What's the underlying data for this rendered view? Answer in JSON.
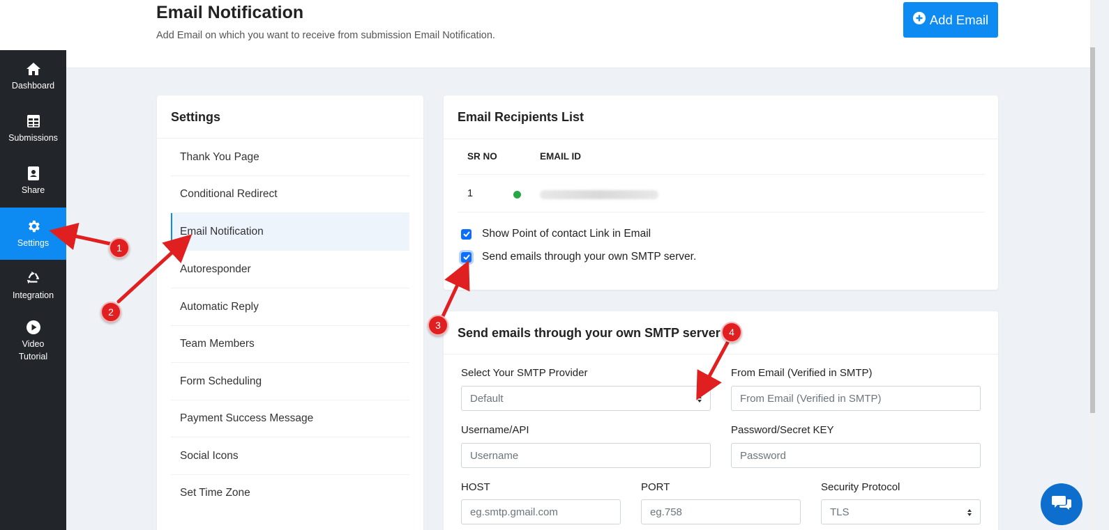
{
  "sidebar": {
    "items": [
      {
        "label": "Dashboard",
        "icon": "home-icon"
      },
      {
        "label": "Submissions",
        "icon": "table-icon"
      },
      {
        "label": "Share",
        "icon": "share-icon"
      },
      {
        "label": "Settings",
        "icon": "gear-icon",
        "active": true
      },
      {
        "label": "Integration",
        "icon": "recycle-icon"
      },
      {
        "label": "Video\nTutorial",
        "icon": "play-icon"
      }
    ]
  },
  "header": {
    "title": "Email Notification",
    "subtitle": "Add Email on which you want to receive from submission Email Notification.",
    "add_button": "Add Email"
  },
  "settings": {
    "title": "Settings",
    "items": [
      "Thank You Page",
      "Conditional Redirect",
      "Email Notification",
      "Autoresponder",
      "Automatic Reply",
      "Team Members",
      "Form Scheduling",
      "Payment Success Message",
      "Social Icons",
      "Set Time Zone"
    ],
    "active_index": 2
  },
  "recipients": {
    "title": "Email Recipients List",
    "columns": [
      "SR NO",
      "EMAIL ID"
    ],
    "rows": [
      {
        "sr": "1",
        "status": "active"
      }
    ],
    "checkbox_contact": "Show Point of contact Link in Email",
    "checkbox_smtp": "Send emails through your own SMTP server."
  },
  "smtp": {
    "title": "Send emails through your own SMTP server",
    "provider_label": "Select Your SMTP Provider",
    "provider_value": "Default",
    "from_label": "From Email (Verified in SMTP)",
    "from_placeholder": "From Email (Verified in SMTP)",
    "username_label": "Username/API",
    "username_placeholder": "Username",
    "password_label": "Password/Secret KEY",
    "password_placeholder": "Password",
    "host_label": "HOST",
    "host_placeholder": "eg.smtp.gmail.com",
    "port_label": "PORT",
    "port_placeholder": "eg.758",
    "protocol_label": "Security Protocol",
    "protocol_value": "TLS"
  },
  "annotations": [
    "1",
    "2",
    "3",
    "4"
  ],
  "colors": {
    "accent": "#0d8bf2",
    "sidebar_bg": "#22262b",
    "arrow": "#e02020",
    "status_active": "#28a745"
  }
}
